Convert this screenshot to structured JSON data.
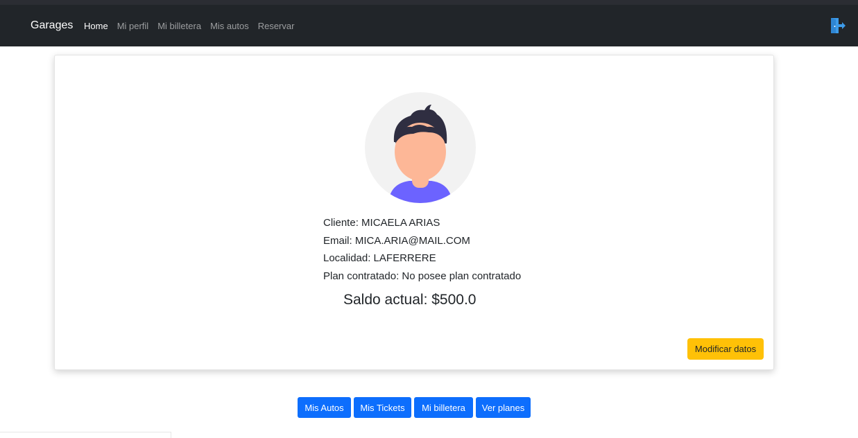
{
  "navbar": {
    "brand": "Garages",
    "links": [
      {
        "label": "Home",
        "active": true
      },
      {
        "label": "Mi perfil",
        "active": false
      },
      {
        "label": "Mi billetera",
        "active": false
      },
      {
        "label": "Mis autos",
        "active": false
      },
      {
        "label": "Reservar",
        "active": false
      }
    ],
    "logout_icon": "logout-door-icon"
  },
  "profile": {
    "avatar_icon": "user-avatar-icon",
    "client": "Cliente: MICAELA ARIAS",
    "email": "Email: MICA.ARIA@MAIL.COM",
    "locality": "Localidad: LAFERRERE",
    "plan": "Plan contratado: No posee plan contratado",
    "balance": "Saldo actual: $500.0",
    "edit_button": "Modificar datos"
  },
  "actions": [
    {
      "label": "Mis Autos"
    },
    {
      "label": "Mis Tickets"
    },
    {
      "label": "Mi billetera"
    },
    {
      "label": "Ver planes"
    }
  ],
  "colors": {
    "navbar": "#212529",
    "primary": "#0d6efd",
    "warning": "#ffc107",
    "logout_icon": "#3d9be9"
  }
}
